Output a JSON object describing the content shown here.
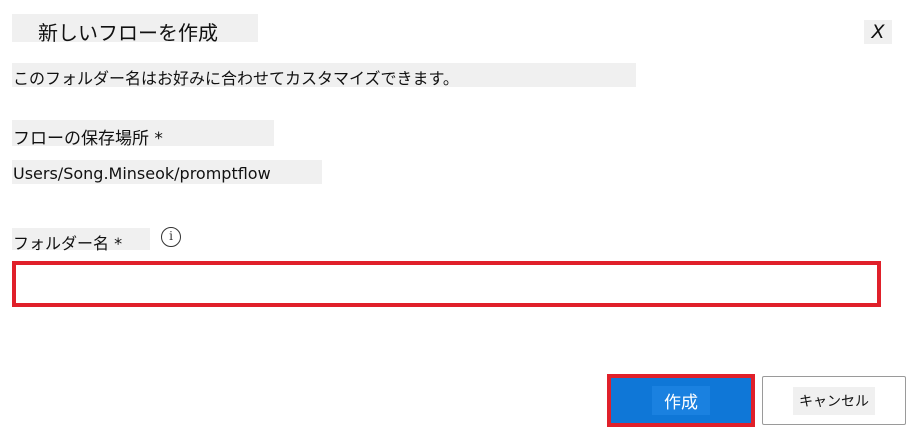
{
  "dialog": {
    "title": "新しいフローを作成",
    "close_label": "X",
    "description": "このフォルダー名はお好みに合わせてカスタマイズできます。"
  },
  "location": {
    "label": "フローの保存場所 *",
    "value": "Users/Song.Minseok/promptflow"
  },
  "folder": {
    "label": "フォルダー名 *",
    "info_icon": "i",
    "value": "",
    "placeholder": ""
  },
  "buttons": {
    "create_label": "作成",
    "cancel_label": "キャンセル"
  },
  "colors": {
    "primary": "#0f77d7",
    "highlight_border": "#e0202a",
    "label_background": "#f0f0f0"
  }
}
